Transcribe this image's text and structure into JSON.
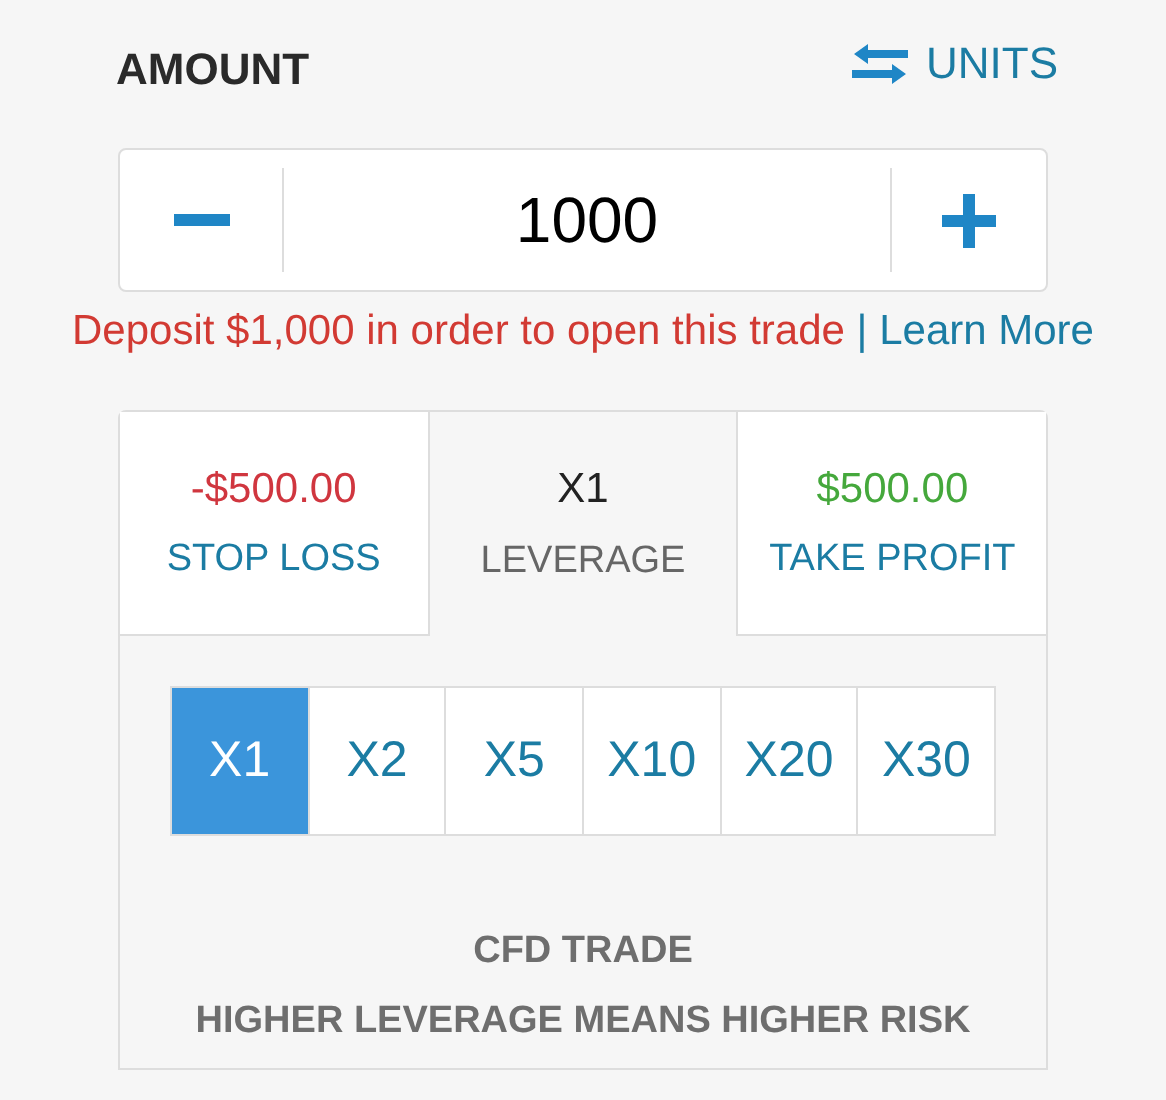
{
  "amount": {
    "label": "AMOUNT",
    "units_toggle": "UNITS",
    "value": "1000"
  },
  "warning": {
    "message": "Deposit $1,000 in order to open this trade",
    "separator": "|",
    "link": "Learn More"
  },
  "tabs": [
    {
      "value": "-$500.00",
      "label": "STOP LOSS",
      "kind": "loss",
      "selected": false
    },
    {
      "value": "X1",
      "label": "LEVERAGE",
      "kind": "leverage",
      "selected": true
    },
    {
      "value": "$500.00",
      "label": "TAKE PROFIT",
      "kind": "profit",
      "selected": false
    }
  ],
  "leverage_options": [
    {
      "label": "X1",
      "selected": true
    },
    {
      "label": "X2",
      "selected": false
    },
    {
      "label": "X5",
      "selected": false
    },
    {
      "label": "X10",
      "selected": false
    },
    {
      "label": "X20",
      "selected": false
    },
    {
      "label": "X30",
      "selected": false
    }
  ],
  "notice": {
    "title": "CFD TRADE",
    "text": "HIGHER LEVERAGE MEANS HIGHER RISK"
  }
}
